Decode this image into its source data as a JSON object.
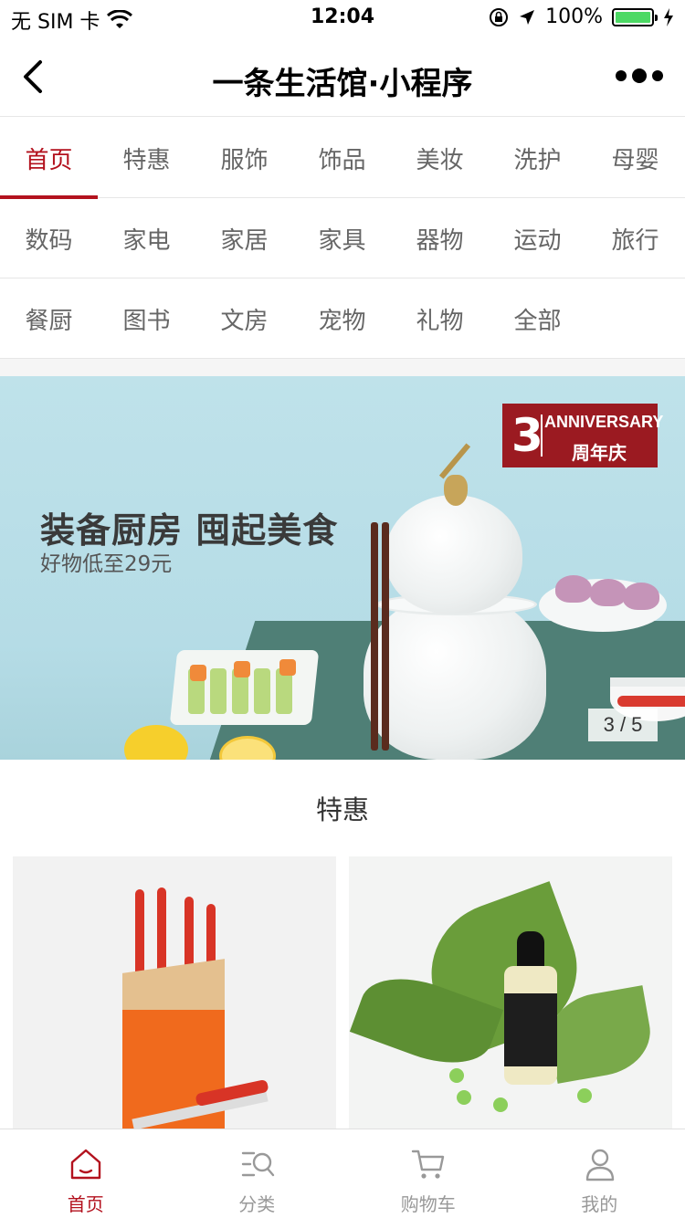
{
  "status_bar": {
    "carrier": "无 SIM 卡",
    "time": "12:04",
    "battery": "100%",
    "battery_level": 1.0
  },
  "nav": {
    "title": "一条生活馆·小程序"
  },
  "categories": [
    [
      "首页",
      "特惠",
      "服饰",
      "饰品",
      "美妆",
      "洗护",
      "母婴"
    ],
    [
      "数码",
      "家电",
      "家居",
      "家具",
      "器物",
      "运动",
      "旅行"
    ],
    [
      "餐厨",
      "图书",
      "文房",
      "宠物",
      "礼物",
      "全部"
    ]
  ],
  "banner": {
    "title": "装备厨房 囤起美食",
    "subtitle": "好物低至29元",
    "badge_number": "3",
    "badge_en": "ANNIVERSARY",
    "badge_cn": "周年庆",
    "pager": "3 / 5"
  },
  "section": {
    "title": "特惠"
  },
  "tabs": {
    "home": "首页",
    "category": "分类",
    "cart": "购物车",
    "mine": "我的"
  },
  "colors": {
    "accent": "#b3121e",
    "badge": "#9b1a21",
    "battery": "#4cd964"
  }
}
